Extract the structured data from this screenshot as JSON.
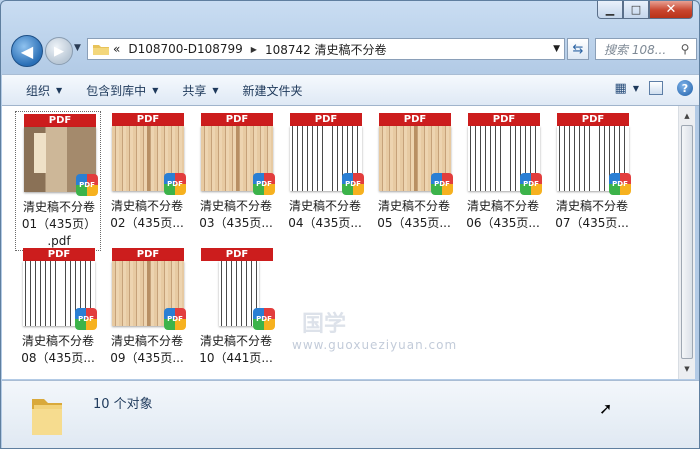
{
  "address": {
    "prefix": "«",
    "crumbs": [
      "D108700-D108799",
      "108742 清史稿不分卷"
    ],
    "sep": "▶"
  },
  "search": {
    "placeholder": "搜索 108..."
  },
  "toolbar": {
    "organize": "组织",
    "include_library": "包含到库中",
    "share": "共享",
    "new_folder": "新建文件夹"
  },
  "files": [
    {
      "name_line1": "清史稿不分卷",
      "name_line2": "01（435页）",
      "name_line3": ".pdf",
      "thumb": "cover"
    },
    {
      "name_line1": "清史稿不分卷",
      "name_line2": "02（435页...",
      "thumb": "aged"
    },
    {
      "name_line1": "清史稿不分卷",
      "name_line2": "03（435页...",
      "thumb": "aged"
    },
    {
      "name_line1": "清史稿不分卷",
      "name_line2": "04（435页...",
      "thumb": "white"
    },
    {
      "name_line1": "清史稿不分卷",
      "name_line2": "05（435页...",
      "thumb": "aged"
    },
    {
      "name_line1": "清史稿不分卷",
      "name_line2": "06（435页...",
      "thumb": "white"
    },
    {
      "name_line1": "清史稿不分卷",
      "name_line2": "07（435页...",
      "thumb": "white"
    },
    {
      "name_line1": "清史稿不分卷",
      "name_line2": "08（435页...",
      "thumb": "white"
    },
    {
      "name_line1": "清史稿不分卷",
      "name_line2": "09（435页...",
      "thumb": "aged"
    },
    {
      "name_line1": "清史稿不分卷",
      "name_line2": "10（441页...",
      "thumb": "narrow"
    }
  ],
  "pdf_label": "PDF",
  "status": {
    "count": "10 个对象"
  },
  "watermark": {
    "text": "国学",
    "url": "www.guoxueziyuan.com"
  },
  "colors": {
    "pdf_bar": "#cc1d1d",
    "accent": "#1e395b"
  }
}
